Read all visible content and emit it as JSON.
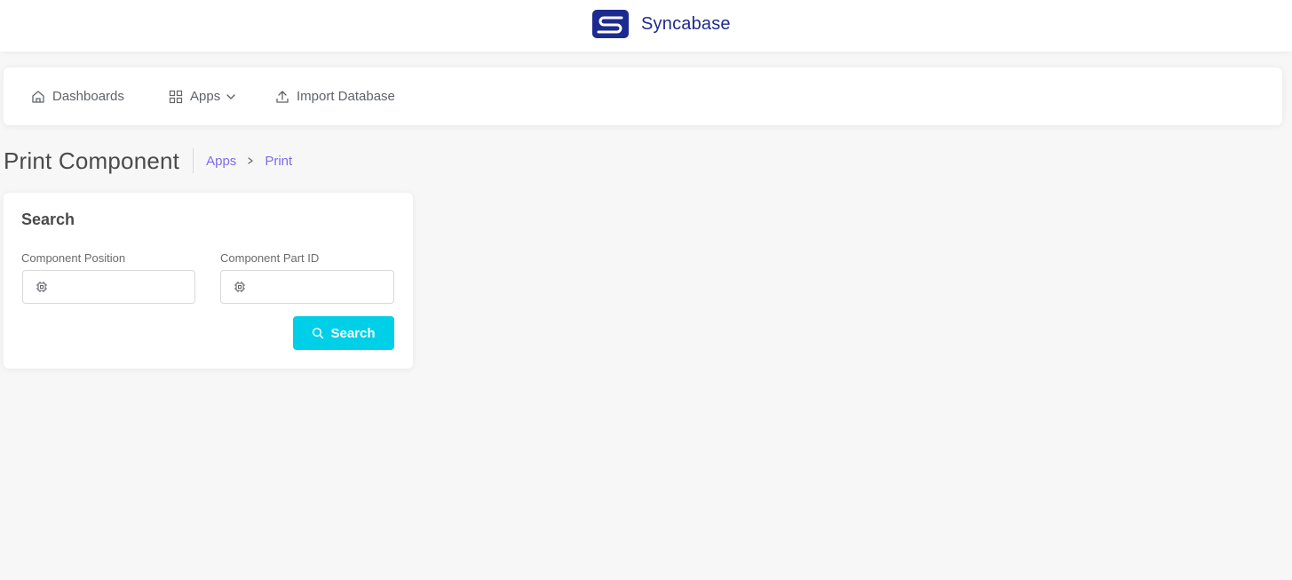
{
  "brand": {
    "name": "Syncabase",
    "logo_icon": "syncabase-logo",
    "color": "#1d2b8f"
  },
  "nav": {
    "items": [
      {
        "label": "Dashboards",
        "icon": "home-icon"
      },
      {
        "label": "Apps",
        "icon": "grid-icon",
        "dropdown": true
      },
      {
        "label": "Import Database",
        "icon": "upload-icon"
      }
    ]
  },
  "page": {
    "title": "Print Component",
    "breadcrumb": [
      "Apps",
      "Print"
    ],
    "accent": "#7b6ee8"
  },
  "search_card": {
    "title": "Search",
    "fields": [
      {
        "label": "Component Position",
        "value": "",
        "icon": "chip-icon"
      },
      {
        "label": "Component Part ID",
        "value": "",
        "icon": "chip-icon"
      }
    ],
    "button_label": "Search",
    "button_color": "#00cfe8"
  }
}
